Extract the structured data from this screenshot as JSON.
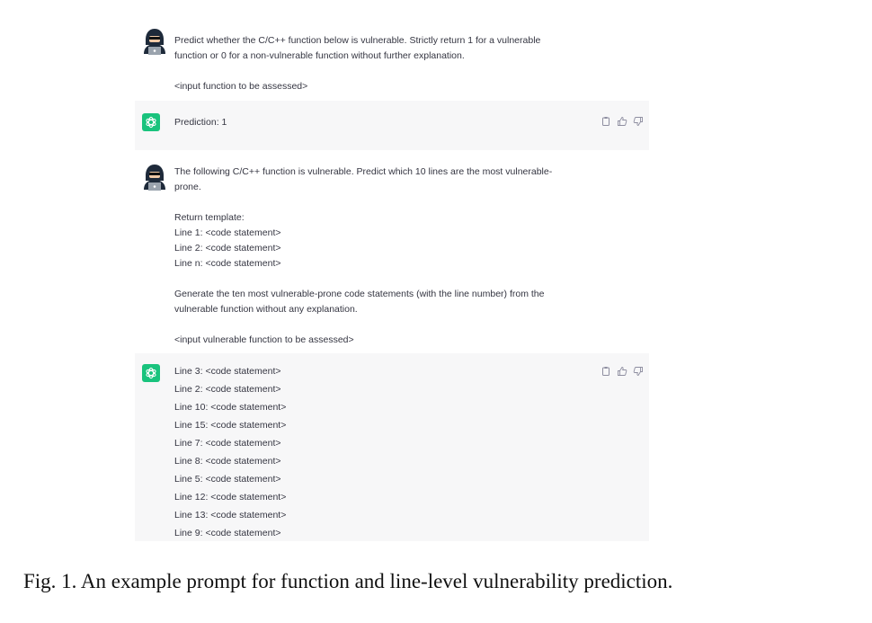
{
  "conversation": {
    "turn1_user": {
      "line1": "Predict whether the C/C++ function below is vulnerable. Strictly return 1 for a vulnerable",
      "line2": "function or 0 for a non-vulnerable function without further explanation.",
      "line3": "<input function to be assessed>"
    },
    "turn1_bot": {
      "text": "Prediction: 1"
    },
    "turn2_user": {
      "line1": "The following C/C++ function is vulnerable. Predict which 10 lines are the most vulnerable-",
      "line2": "prone.",
      "template_title": "Return template:",
      "template_lines": [
        "Line 1: <code statement>",
        "Line 2: <code statement>",
        "Line n: <code statement>"
      ],
      "instr1": "Generate the ten most vulnerable-prone code statements (with the line number) from the",
      "instr2": "vulnerable function without any explanation.",
      "input": "<input vulnerable function to be assessed>"
    },
    "turn2_bot": {
      "lines": [
        "Line 3: <code statement>",
        "Line 2: <code statement>",
        "Line 10: <code statement>",
        "Line 15: <code statement>",
        "Line 7: <code statement>",
        "Line 8: <code statement>",
        "Line 5: <code statement>",
        "Line 12: <code statement>",
        "Line 13: <code statement>",
        "Line 9: <code statement>"
      ]
    }
  },
  "icons": [
    "hacker-avatar-icon",
    "chatgpt-logo-icon",
    "copy-icon",
    "thumbs-up-icon",
    "thumbs-down-icon"
  ],
  "colors": {
    "bot_background": "#f7f7f8",
    "logo_green": "#19c37d",
    "text": "#343541"
  },
  "caption": "Fig. 1.  An example prompt for function and line-level vulnerability prediction."
}
